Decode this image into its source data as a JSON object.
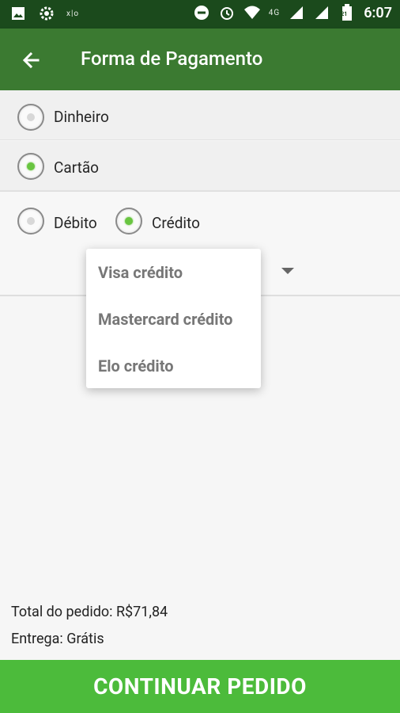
{
  "status_bar": {
    "indicator_text": "x|o",
    "network_label": "4G",
    "battery_level": "21",
    "time": "6:07"
  },
  "app_bar": {
    "title": "Forma de Pagamento"
  },
  "payment_options": [
    {
      "label": "Dinheiro",
      "selected": false
    },
    {
      "label": "Cartão",
      "selected": true
    }
  ],
  "card_type_options": [
    {
      "label": "Débito",
      "selected": false
    },
    {
      "label": "Crédito",
      "selected": true
    }
  ],
  "card_brand_menu": {
    "options": [
      "Visa crédito",
      "Mastercard crédito",
      "Elo crédito"
    ]
  },
  "summary": {
    "total_line": "Total do pedido: R$71,84",
    "delivery_line": "Entrega: Grátis"
  },
  "actions": {
    "continue_label": "CONTINUAR PEDIDO"
  },
  "colors": {
    "status_bar": "#1b4a1c",
    "app_bar": "#3b7a31",
    "accent_green": "#69c541",
    "cta_green": "#4cbb3b"
  }
}
